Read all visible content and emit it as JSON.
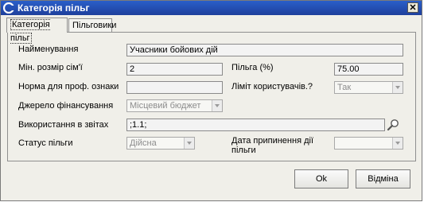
{
  "window": {
    "title": "Категорія пільг"
  },
  "tabs": [
    {
      "label": "Категорія пільг",
      "active": true
    },
    {
      "label": "Пільговики",
      "active": false
    }
  ],
  "form": {
    "name_label": "Найменування",
    "name_value": "Учасники бойових дій",
    "min_family_label": "Мін. розмір сім'ї",
    "min_family_value": "2",
    "benefit_label": "Пільга (%)",
    "benefit_value": "75.00",
    "norm_label": "Норма для проф. ознаки",
    "norm_value": "",
    "limit_label": "Ліміт користувачів.?",
    "limit_value": "Так",
    "funding_label": "Джерело фінансування",
    "funding_value": "Місцевий бюджет",
    "reports_label": "Використання в звітах",
    "reports_value": ";1.1;",
    "status_label": "Статус пільги",
    "status_value": "Дійсна",
    "end_date_label_1": "Дата припинення дії",
    "end_date_label_2": "пільги",
    "end_date_value": ""
  },
  "buttons": {
    "ok": "Ok",
    "cancel": "Відміна"
  },
  "icons": {
    "app": "app-logo-icon",
    "close": "close-icon",
    "search": "magnifier-icon",
    "dropdown": "chevron-down-icon"
  },
  "colors": {
    "title_bar": "#1e3f9c",
    "window_bg": "#f0efe9"
  }
}
